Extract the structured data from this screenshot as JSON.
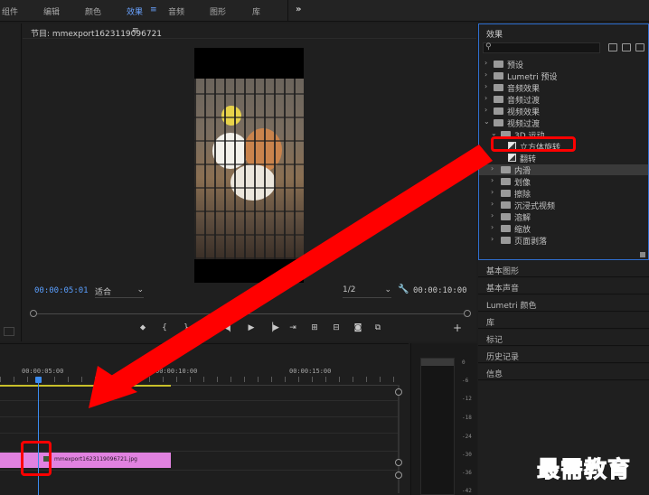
{
  "workspaces": [
    {
      "label": "组件",
      "active": false
    },
    {
      "label": "编辑",
      "active": false
    },
    {
      "label": "颜色",
      "active": false
    },
    {
      "label": "效果",
      "active": true
    },
    {
      "label": "音频",
      "active": false
    },
    {
      "label": "图形",
      "active": false
    },
    {
      "label": "库",
      "active": false
    }
  ],
  "workspace_menu_icon": "≡",
  "workspace_more": "»",
  "monitor": {
    "title": "节目: mmexport1623119096721",
    "menu_icon": "≡",
    "current_time": "00:00:05:01",
    "fit": "适合",
    "resolution": "1/2",
    "duration": "00:00:10:00"
  },
  "effects_panel": {
    "title": "效果",
    "search_placeholder": "",
    "tree": [
      {
        "label": "预设",
        "type": "folder",
        "depth": 0,
        "expanded": false
      },
      {
        "label": "Lumetri 预设",
        "type": "folder",
        "depth": 0,
        "expanded": false
      },
      {
        "label": "音频效果",
        "type": "folder",
        "depth": 0,
        "expanded": false
      },
      {
        "label": "音频过渡",
        "type": "folder",
        "depth": 0,
        "expanded": false
      },
      {
        "label": "视频效果",
        "type": "folder",
        "depth": 0,
        "expanded": false
      },
      {
        "label": "视频过渡",
        "type": "folder",
        "depth": 0,
        "expanded": true
      },
      {
        "label": "3D 运动",
        "type": "folder",
        "depth": 1,
        "expanded": true
      },
      {
        "label": "立方体旋转",
        "type": "effect",
        "depth": 2,
        "highlighted": true
      },
      {
        "label": "翻转",
        "type": "effect",
        "depth": 2
      },
      {
        "label": "内滑",
        "type": "folder",
        "depth": 1,
        "selected": true
      },
      {
        "label": "划像",
        "type": "folder",
        "depth": 1
      },
      {
        "label": "擦除",
        "type": "folder",
        "depth": 1
      },
      {
        "label": "沉浸式视频",
        "type": "folder",
        "depth": 1
      },
      {
        "label": "溶解",
        "type": "folder",
        "depth": 1
      },
      {
        "label": "缩放",
        "type": "folder",
        "depth": 1
      },
      {
        "label": "页面剥落",
        "type": "folder",
        "depth": 1
      }
    ]
  },
  "right_panels": [
    "基本图形",
    "基本声音",
    "Lumetri 颜色",
    "库",
    "标记",
    "历史记录",
    "信息"
  ],
  "timeline": {
    "ruler": [
      "00:00:05:00",
      "00:00:10:00",
      "00:00:15:00"
    ],
    "clip_name": "mmexport1623119096721.jpg"
  },
  "meter_labels": [
    "0",
    "-6",
    "-12",
    "-18",
    "-24",
    "-30",
    "-36",
    "-42"
  ],
  "watermark": "最需教育",
  "colors": {
    "accent_blue": "#3b8cf0",
    "annotation_red": "#ff0000",
    "clip_pink": "#e182e0",
    "work_area_yellow": "#c8c02a"
  }
}
